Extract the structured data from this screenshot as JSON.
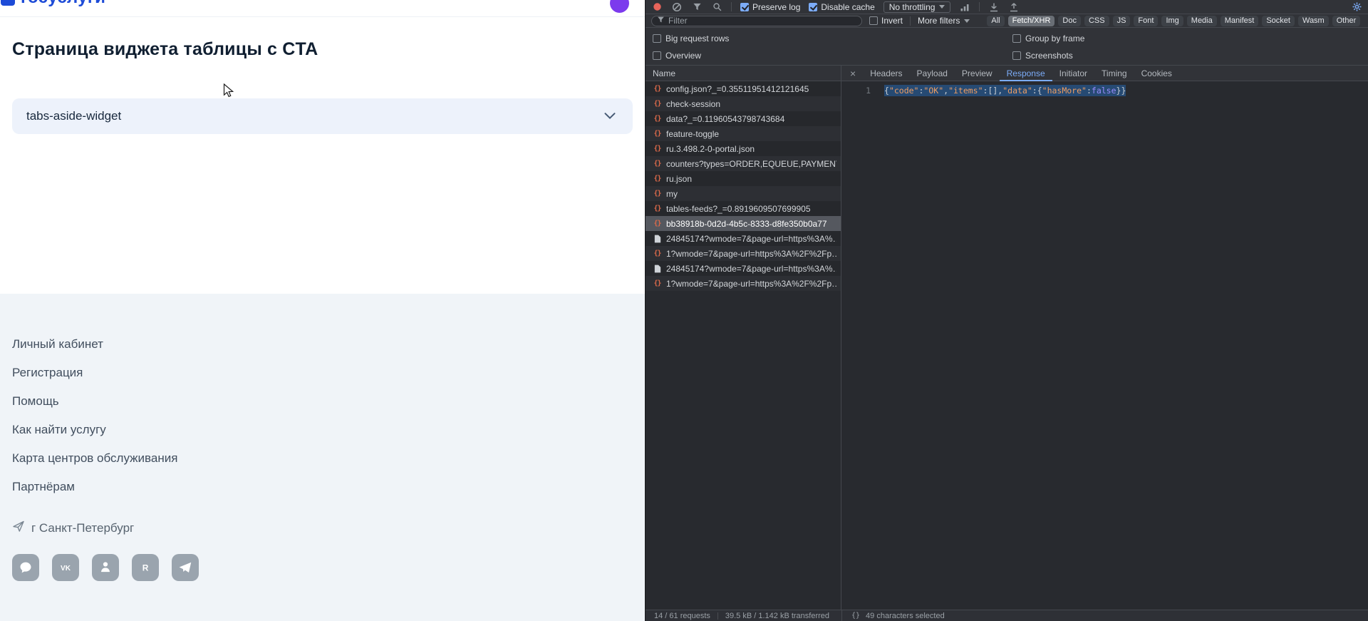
{
  "colors": {
    "accent_blue": "#7cacf8",
    "record_red": "#e8645a",
    "json_icon": "#dd6a4a",
    "selection": "#264a73",
    "logo_blue": "#1d4bd7",
    "avatar_purple": "#7c3aed",
    "accordion_bg": "#edf2fb",
    "footer_bg": "#f0f4f8"
  },
  "page": {
    "logo_text": "госуслуги",
    "title": "Страница виджета таблицы с CTA",
    "accordion": {
      "label": "tabs-aside-widget"
    },
    "footer": {
      "links": [
        "Личный кабинет",
        "Регистрация",
        "Помощь",
        "Как найти услугу",
        "Карта центров обслуживания",
        "Партнёрам"
      ],
      "location": "г Санкт-Петербург",
      "social": [
        {
          "name": "messenger"
        },
        {
          "name": "vk"
        },
        {
          "name": "ok"
        },
        {
          "name": "rutube"
        },
        {
          "name": "telegram"
        }
      ]
    }
  },
  "devtools": {
    "toolbar": {
      "preserve_log": {
        "label": "Preserve log",
        "checked": true
      },
      "disable_cache": {
        "label": "Disable cache",
        "checked": true
      },
      "throttling": "No throttling",
      "filter_placeholder": "Filter",
      "invert": {
        "label": "Invert",
        "checked": false
      },
      "more_filters": "More filters",
      "chips": [
        {
          "label": "All"
        },
        {
          "label": "Fetch/XHR",
          "selected": true
        },
        {
          "label": "Doc"
        },
        {
          "label": "CSS"
        },
        {
          "label": "JS"
        },
        {
          "label": "Font"
        },
        {
          "label": "Img"
        },
        {
          "label": "Media"
        },
        {
          "label": "Manifest"
        },
        {
          "label": "Socket"
        },
        {
          "label": "Wasm"
        },
        {
          "label": "Other"
        }
      ],
      "options_left": [
        {
          "label": "Big request rows",
          "checked": false
        },
        {
          "label": "Overview",
          "checked": false
        }
      ],
      "options_right": [
        {
          "label": "Group by frame",
          "checked": false
        },
        {
          "label": "Screenshots",
          "checked": false
        }
      ]
    },
    "network": {
      "name_header": "Name",
      "requests": [
        {
          "icon": "json",
          "name": "config.json?_=0.35511951412121645"
        },
        {
          "icon": "json",
          "name": "check-session"
        },
        {
          "icon": "json",
          "name": "data?_=0.11960543798743684"
        },
        {
          "icon": "json",
          "name": "feature-toggle"
        },
        {
          "icon": "json",
          "name": "ru.3.498.2-0-portal.json"
        },
        {
          "icon": "json",
          "name": "counters?types=ORDER,EQUEUE,PAYMENT,G…"
        },
        {
          "icon": "json",
          "name": "ru.json"
        },
        {
          "icon": "json",
          "name": "my"
        },
        {
          "icon": "json",
          "name": "tables-feeds?_=0.8919609507699905"
        },
        {
          "icon": "json",
          "name": "bb38918b-0d2d-4b5c-8333-d8fe350b0a77",
          "selected": true
        },
        {
          "icon": "doc",
          "name": "24845174?wmode=7&page-url=https%3A%…"
        },
        {
          "icon": "json",
          "name": "1?wmode=7&page-url=https%3A%2F%2Fp…"
        },
        {
          "icon": "doc",
          "name": "24845174?wmode=7&page-url=https%3A%…"
        },
        {
          "icon": "json",
          "name": "1?wmode=7&page-url=https%3A%2F%2Fp…"
        }
      ]
    },
    "detail": {
      "close_label": "×",
      "tabs": [
        "Headers",
        "Payload",
        "Preview",
        "Response",
        "Initiator",
        "Timing",
        "Cookies"
      ],
      "active_tab": "Response",
      "response": {
        "line_number": "1",
        "segments": [
          {
            "type": "p",
            "text": "{"
          },
          {
            "type": "s",
            "text": "\"code\""
          },
          {
            "type": "p",
            "text": ":"
          },
          {
            "type": "s",
            "text": "\"OK\""
          },
          {
            "type": "p",
            "text": ","
          },
          {
            "type": "s",
            "text": "\"items\""
          },
          {
            "type": "p",
            "text": ":[],"
          },
          {
            "type": "s",
            "text": "\"data\""
          },
          {
            "type": "p",
            "text": ":{"
          },
          {
            "type": "s",
            "text": "\"hasMore\""
          },
          {
            "type": "p",
            "text": ":"
          },
          {
            "type": "b",
            "text": "false"
          },
          {
            "type": "p",
            "text": "}}"
          }
        ]
      }
    },
    "statusbar": {
      "requests_summary": "14 / 61 requests",
      "transfer_summary": "39.5 kB / 1.142 kB transferred",
      "format_label": "{}",
      "selection_summary": "49 characters selected"
    }
  }
}
